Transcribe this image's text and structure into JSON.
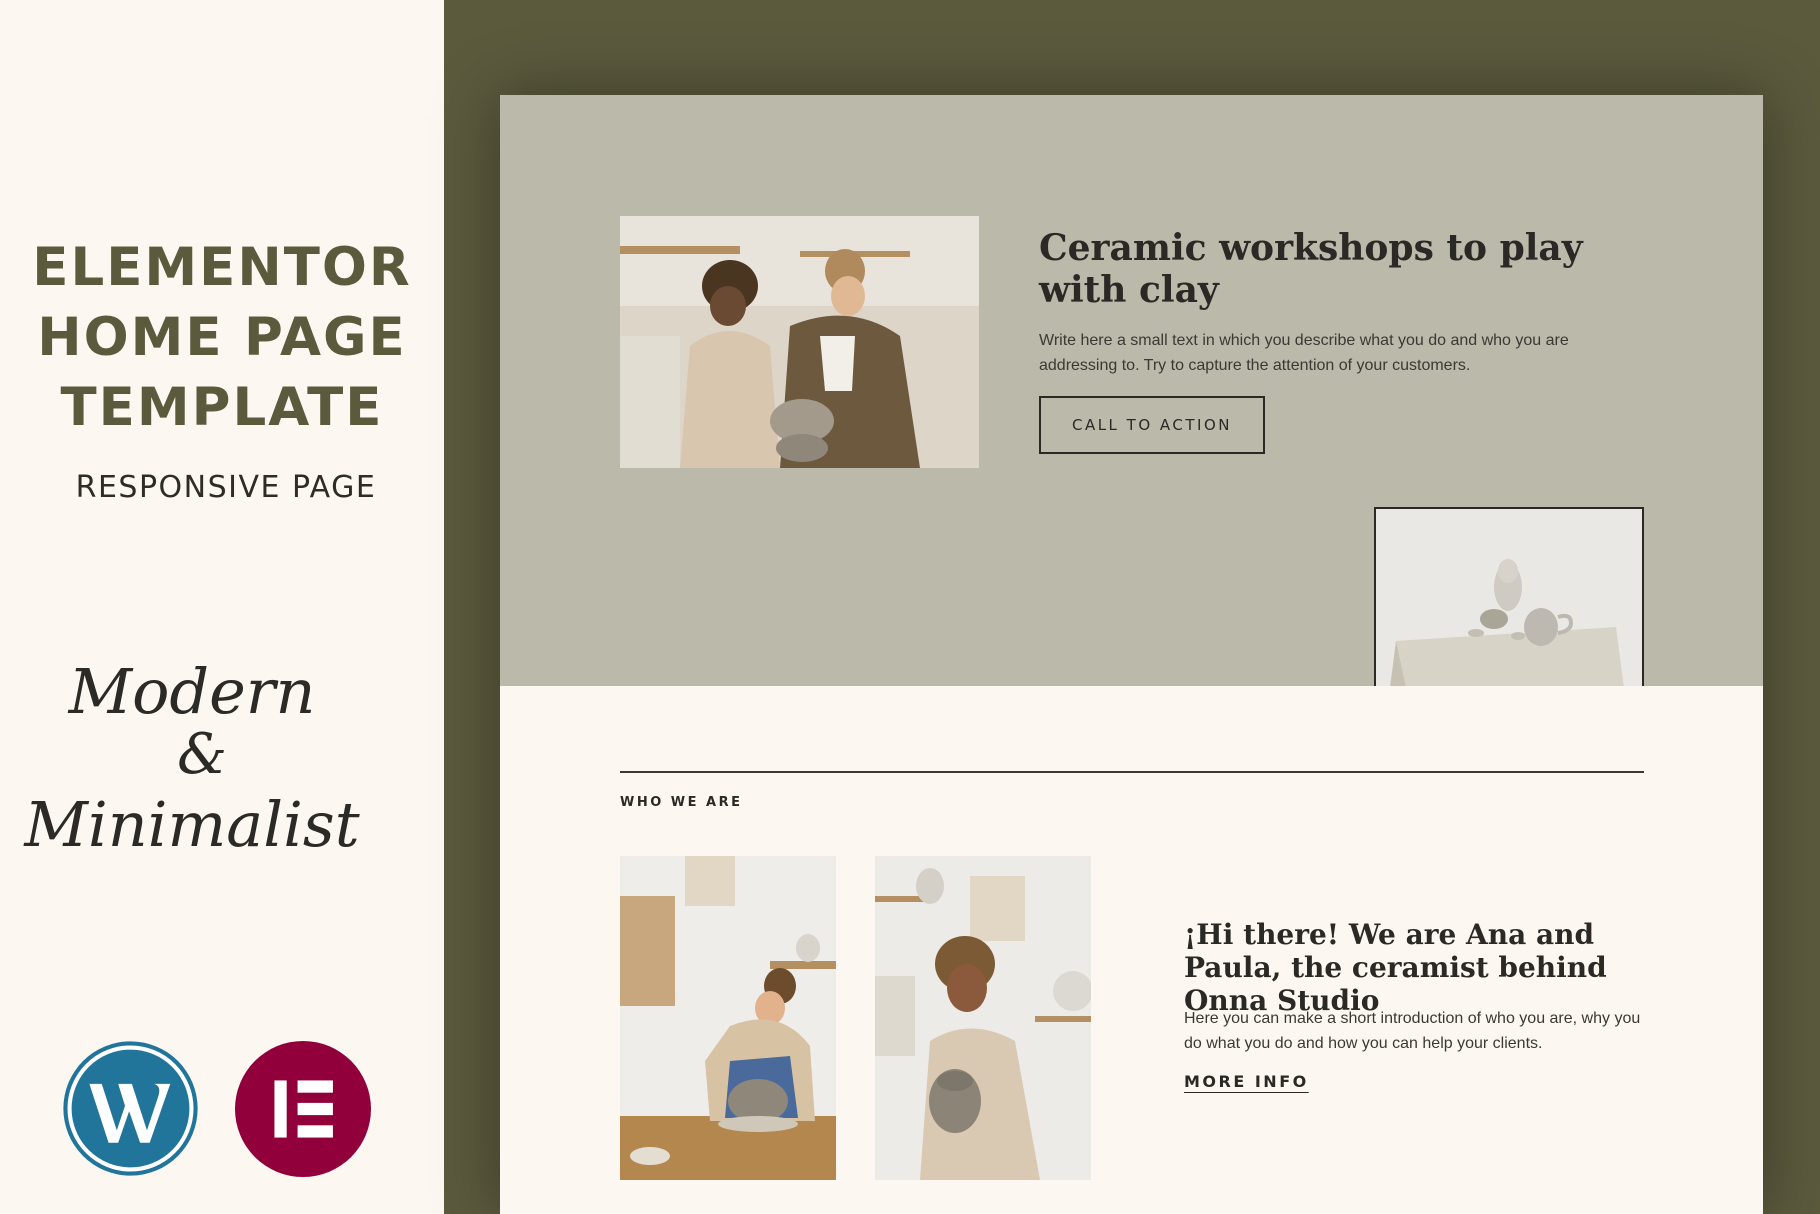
{
  "promo": {
    "title_lines": [
      "ELEMENTOR",
      "HOME PAGE",
      "TEMPLATE"
    ],
    "subtitle": "RESPONSIVE PAGE",
    "script_lines": [
      "Modern",
      "&",
      "Minimalist"
    ],
    "logos": {
      "wordpress": {
        "icon": "wordpress-logo-icon",
        "color": "#21759b"
      },
      "elementor": {
        "icon": "elementor-logo-icon",
        "color": "#92003b"
      }
    }
  },
  "hero": {
    "heading": "Ceramic workshops to play with clay",
    "text": "Write here a small text in which you describe what you do and who you are addressing to. Try to capture the attention of your customers.",
    "cta_label": "CALL TO ACTION"
  },
  "about": {
    "section_label": "WHO WE ARE",
    "heading": "¡Hi there! We are Ana and Paula, the ceramist behind Onna Studio",
    "text": "Here you can make a short introduction of who you are, why you do what you do and how you can help your clients.",
    "link_label": "MORE INFO"
  },
  "colors": {
    "olive": "#5b5a3d",
    "cream": "#fcf8f1",
    "sage": "#bab9aa",
    "ink": "#2a2925"
  }
}
